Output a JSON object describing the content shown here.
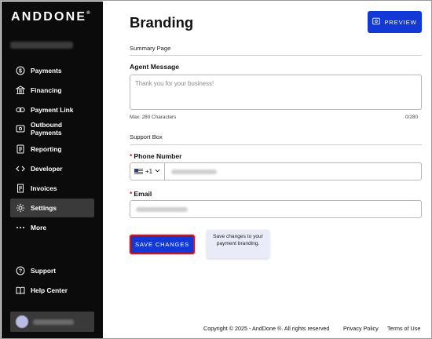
{
  "sidebar": {
    "logo_text": "ANDDONE",
    "logo_mark": "®",
    "items": [
      {
        "label": "Payments",
        "icon": "dollar-circle-icon"
      },
      {
        "label": "Financing",
        "icon": "bank-icon"
      },
      {
        "label": "Payment Link",
        "icon": "link-icon"
      },
      {
        "label": "Outbound Payments",
        "icon": "outbound-icon"
      },
      {
        "label": "Reporting",
        "icon": "report-icon"
      },
      {
        "label": "Developer",
        "icon": "code-icon"
      },
      {
        "label": "Invoices",
        "icon": "invoice-icon"
      },
      {
        "label": "Settings",
        "icon": "gear-icon",
        "active": true
      },
      {
        "label": "More",
        "icon": "dots-icon"
      }
    ],
    "bottom_items": [
      {
        "label": "Support",
        "icon": "help-circle-icon"
      },
      {
        "label": "Help Center",
        "icon": "book-icon"
      }
    ]
  },
  "header": {
    "title": "Branding",
    "preview_label": "PREVIEW"
  },
  "summary": {
    "section_title": "Summary Page",
    "agent_message_label": "Agent Message",
    "agent_message_placeholder": "Thank you for your business!",
    "max_label": "Max: 280 Characters",
    "count": "0/280"
  },
  "support": {
    "section_title": "Support Box",
    "required_marker": "*",
    "phone_label": "Phone Number",
    "country_code": "+1",
    "email_label": "Email"
  },
  "actions": {
    "save_label": "SAVE CHANGES",
    "tooltip": "Save changes to your payment branding."
  },
  "footer": {
    "copyright": "Copyright © 2025 - AndDone ®. All rights reserved",
    "privacy": "Privacy Policy",
    "terms": "Terms of Use"
  },
  "colors": {
    "sidebar_bg": "#0b0b0b",
    "accent": "#1238d6",
    "required": "#d32020"
  }
}
